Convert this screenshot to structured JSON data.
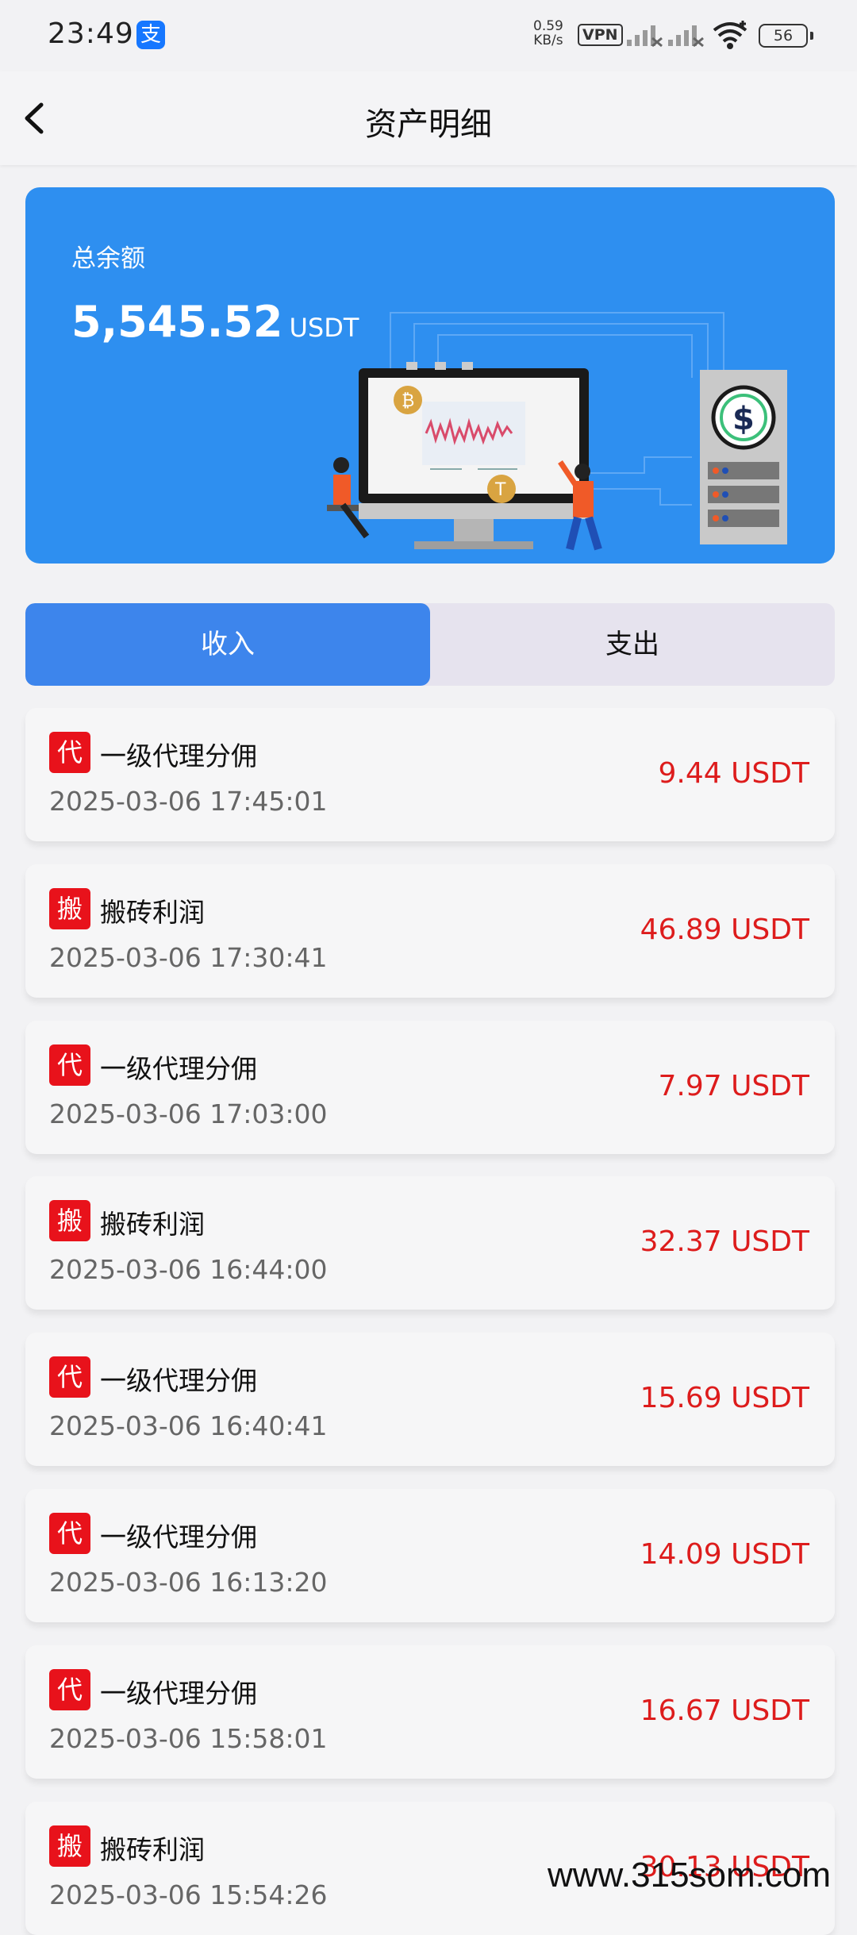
{
  "status_bar": {
    "time": "23:49",
    "app_icon": "支",
    "net_speed_value": "0.59",
    "net_speed_unit": "KB/s",
    "vpn": "VPN",
    "battery": "56"
  },
  "header": {
    "title": "资产明细",
    "back_icon": "chevron-left-icon"
  },
  "balance": {
    "label": "总余额",
    "amount": "5,545.52",
    "unit": "USDT"
  },
  "tabs": [
    {
      "label": "收入",
      "active": true
    },
    {
      "label": "支出",
      "active": false
    }
  ],
  "transactions": [
    {
      "badge": "代",
      "title": "一级代理分佣",
      "time": "2025-03-06 17:45:01",
      "amount": "9.44 USDT"
    },
    {
      "badge": "搬",
      "title": "搬砖利润",
      "time": "2025-03-06 17:30:41",
      "amount": "46.89 USDT"
    },
    {
      "badge": "代",
      "title": "一级代理分佣",
      "time": "2025-03-06 17:03:00",
      "amount": "7.97 USDT"
    },
    {
      "badge": "搬",
      "title": "搬砖利润",
      "time": "2025-03-06 16:44:00",
      "amount": "32.37 USDT"
    },
    {
      "badge": "代",
      "title": "一级代理分佣",
      "time": "2025-03-06 16:40:41",
      "amount": "15.69 USDT"
    },
    {
      "badge": "代",
      "title": "一级代理分佣",
      "time": "2025-03-06 16:13:20",
      "amount": "14.09 USDT"
    },
    {
      "badge": "代",
      "title": "一级代理分佣",
      "time": "2025-03-06 15:58:01",
      "amount": "16.67 USDT"
    },
    {
      "badge": "搬",
      "title": "搬砖利润",
      "time": "2025-03-06 15:54:26",
      "amount": "30.13 USDT"
    }
  ],
  "watermark": "www.315som.com",
  "colors": {
    "card_blue": "#2e8ff0",
    "tab_active": "#3d85ec",
    "badge_red": "#e8121b",
    "amount_red": "#dd1c1c"
  }
}
